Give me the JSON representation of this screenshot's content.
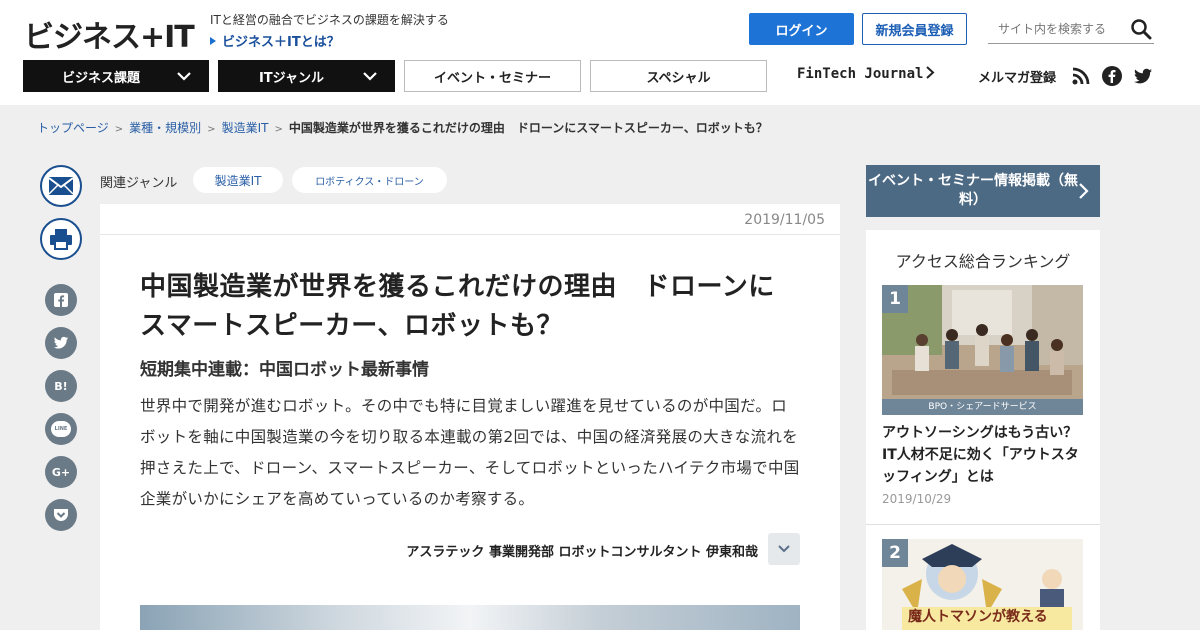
{
  "header": {
    "logo": "ビジネス+IT",
    "tagline": "ITと経営の融合でビジネスの課題を解決する",
    "about_link": "ビジネス＋ITとは？",
    "login_label": "ログイン",
    "register_label": "新規会員登録",
    "search_placeholder": "サイト内を検索する"
  },
  "nav": {
    "business": "ビジネス課題",
    "it_genre": "ITジャンル",
    "events": "イベント・セミナー",
    "special": "スペシャル",
    "fintech": "FinTech Journal",
    "mailmag": "メルマガ登録"
  },
  "breadcrumb": {
    "items": [
      "トップページ",
      "業種・規模別",
      "製造業IT"
    ],
    "current": "中国製造業が世界を獲るこれだけの理由　ドローンにスマートスピーカー、ロボットも？"
  },
  "genre": {
    "label": "関連ジャンル",
    "tags": [
      "製造業IT",
      "ロボティクス・ドローン"
    ]
  },
  "share": {
    "hatena_label": "B!",
    "google_label": "G+",
    "line_label": "LINE"
  },
  "article": {
    "date": "2019/11/05",
    "title": "中国製造業が世界を獲るこれだけの理由　ドローンにスマートスピーカー、ロボットも？",
    "subtitle": "短期集中連載：中国ロボット最新事情",
    "lead": "世界中で開発が進むロボット。その中でも特に目覚ましい躍進を見せているのが中国だ。ロボットを軸に中国製造業の今を切り取る本連載の第2回では、中国の経済発展の大きな流れを押さえた上で、ドローン、スマートスピーカー、そしてロボットといったハイテク市場で中国企業がいかにシェアを高めていっているのか考察する。",
    "author": "アスラテック 事業開発部 ロボットコンサルタント 伊東和哉"
  },
  "sidebar": {
    "event_button": "イベント・セミナー情報掲載（無料）",
    "ranking_title": "アクセス総合ランキング",
    "ranking": [
      {
        "rank": "1",
        "caption": "BPO・シェアードサービス",
        "headline": "アウトソーシングはもう古い？IT人材不足に効く「アウトスタッフィング」とは",
        "date": "2019/10/29"
      },
      {
        "rank": "2",
        "image_text": "魔人トマソンが教える"
      }
    ]
  },
  "colors": {
    "accent_blue": "#1d73d6",
    "nav_dark": "#111111",
    "sidebar_slate": "#4d6a85"
  }
}
